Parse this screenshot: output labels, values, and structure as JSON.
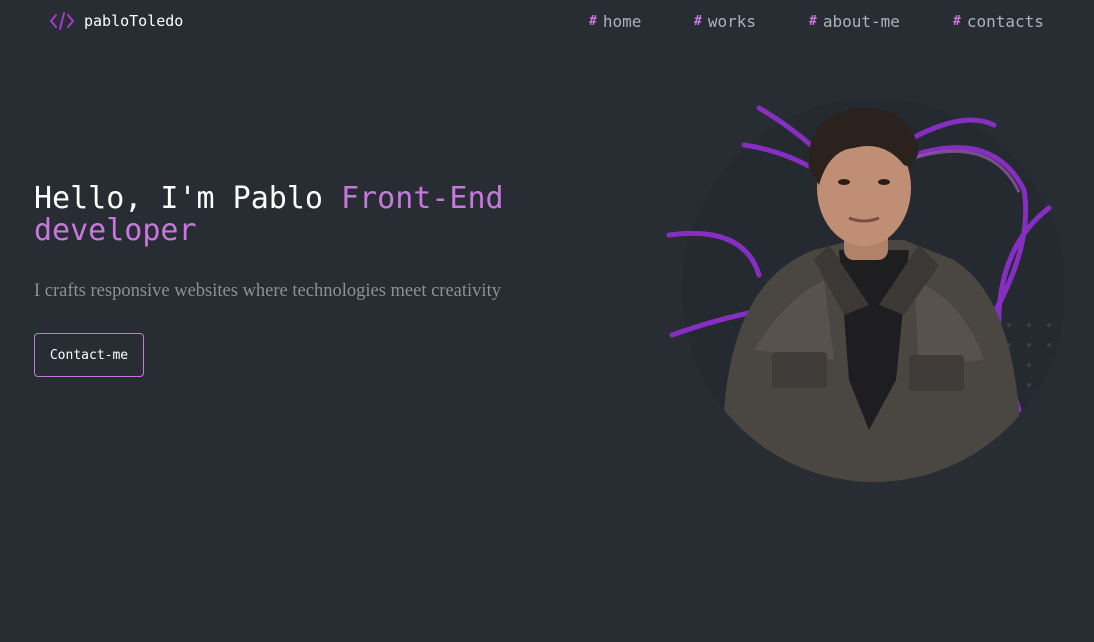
{
  "header": {
    "logo_icon": "code-brackets-icon",
    "logo_text": "pabloToledo",
    "nav": [
      {
        "hash": "#",
        "label": "home"
      },
      {
        "hash": "#",
        "label": "works"
      },
      {
        "hash": "#",
        "label": "about-me"
      },
      {
        "hash": "#",
        "label": "contacts"
      }
    ]
  },
  "hero": {
    "headline_plain": "Hello, I'm Pablo ",
    "headline_accent": "Front-End developer",
    "tagline": "I crafts responsive websites where technologies meet creativity",
    "cta_label": "Contact-me",
    "portrait": "portrait-photo-with-purple-decorative-lines"
  },
  "colors": {
    "background": "#282c33",
    "accent": "#c778dd",
    "nav_text": "#abb2bf",
    "tagline_text": "#8b9099",
    "text": "#ffffff"
  }
}
